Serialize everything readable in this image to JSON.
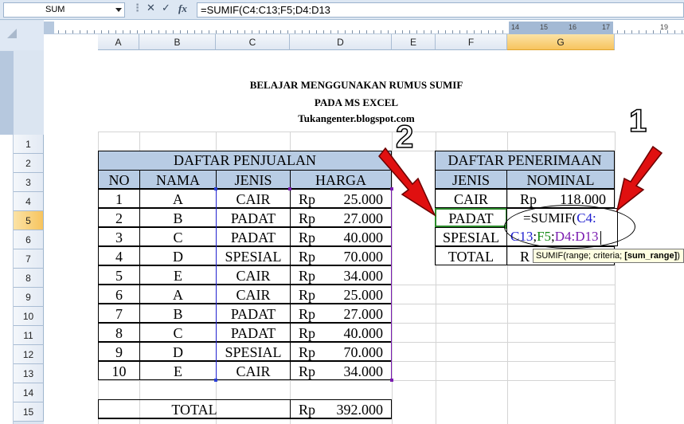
{
  "formula_bar": {
    "name_box": "SUM",
    "cancel_glyph": "✕",
    "enter_glyph": "✓",
    "fx_label": "fx",
    "formula": "=SUMIF(C4:C13;F5;D4:D13"
  },
  "ruler": {
    "numbers": [
      "14",
      "15",
      "16",
      "17",
      "19"
    ]
  },
  "columns": [
    "A",
    "B",
    "C",
    "D",
    "E",
    "F",
    "G"
  ],
  "selected_column": "G",
  "rows": [
    "1",
    "2",
    "3",
    "4",
    "5",
    "6",
    "7",
    "8",
    "9",
    "10",
    "11",
    "12",
    "13",
    "14",
    "15"
  ],
  "selected_row": "5",
  "page_header": {
    "line1": "BELAJAR MENGGUNAKAN RUMUS SUMIF",
    "line2": "PADA MS EXCEL",
    "line3": "Tukangenter.blogspot.com"
  },
  "sales_table": {
    "title": "DAFTAR PENJUALAN",
    "headers": [
      "NO",
      "NAMA",
      "JENIS",
      "HARGA"
    ],
    "rows": [
      {
        "no": "1",
        "nama": "A",
        "jenis": "CAIR",
        "rp": "Rp",
        "harga": "25.000"
      },
      {
        "no": "2",
        "nama": "B",
        "jenis": "PADAT",
        "rp": "Rp",
        "harga": "27.000"
      },
      {
        "no": "3",
        "nama": "C",
        "jenis": "PADAT",
        "rp": "Rp",
        "harga": "40.000"
      },
      {
        "no": "4",
        "nama": "D",
        "jenis": "SPESIAL",
        "rp": "Rp",
        "harga": "70.000"
      },
      {
        "no": "5",
        "nama": "E",
        "jenis": "CAIR",
        "rp": "Rp",
        "harga": "34.000"
      },
      {
        "no": "6",
        "nama": "A",
        "jenis": "CAIR",
        "rp": "Rp",
        "harga": "25.000"
      },
      {
        "no": "7",
        "nama": "B",
        "jenis": "PADAT",
        "rp": "Rp",
        "harga": "27.000"
      },
      {
        "no": "8",
        "nama": "C",
        "jenis": "PADAT",
        "rp": "Rp",
        "harga": "40.000"
      },
      {
        "no": "9",
        "nama": "D",
        "jenis": "SPESIAL",
        "rp": "Rp",
        "harga": "70.000"
      },
      {
        "no": "10",
        "nama": "E",
        "jenis": "CAIR",
        "rp": "Rp",
        "harga": "34.000"
      }
    ],
    "total_label": "TOTAL",
    "total_rp": "Rp",
    "total_value": "392.000"
  },
  "receipt_table": {
    "title": "DAFTAR PENERIMAAN",
    "headers": [
      "JENIS",
      "NOMINAL"
    ],
    "rows": [
      {
        "jenis": "CAIR",
        "rp": "Rp",
        "nominal": "118.000"
      },
      {
        "jenis": "PADAT"
      },
      {
        "jenis": "SPESIAL"
      },
      {
        "jenis": "TOTAL",
        "rp": "R"
      }
    ]
  },
  "editing_formula": {
    "part1": "=SUMIF(",
    "ref1a": "C4:",
    "ref1b": "C13",
    "sep1": ";",
    "ref2": "F5",
    "sep2": ";",
    "ref3": "D4:D13"
  },
  "tooltip": {
    "plain": "SUMIF(range; criteria; ",
    "bold": "[sum_range]",
    "end": ")"
  },
  "callouts": {
    "one": "1",
    "two": "2"
  },
  "colors": {
    "header_fill": "#b8cce4",
    "selection": "#2a8a2a",
    "arrow": "#e01010",
    "ref_blue": "#2020d0",
    "ref_green": "#118811",
    "ref_purple": "#7a1bb0"
  }
}
